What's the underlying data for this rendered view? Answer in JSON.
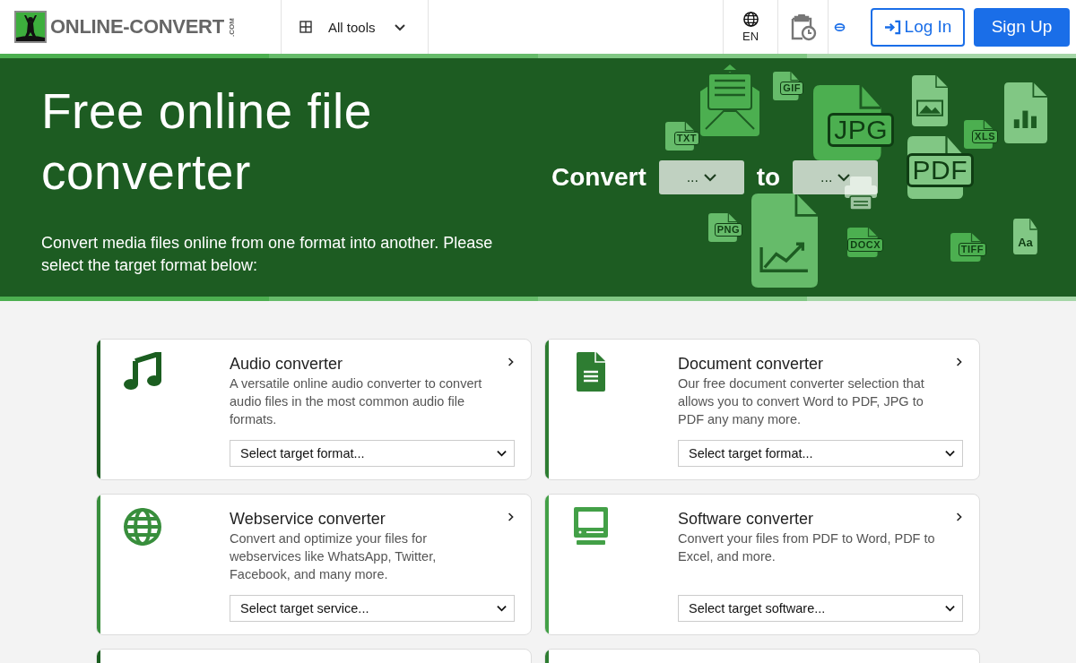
{
  "header": {
    "logo": {
      "text": "ONLINE-CONVERT",
      "suffix": ".COM"
    },
    "all_tools": "All tools",
    "language": "EN",
    "login": "Log In",
    "signup": "Sign Up"
  },
  "hero": {
    "title": "Free online file converter",
    "subtitle": "Convert media files online from one format into another. Please select the target format below:",
    "convert_label": "Convert",
    "from_select": "...",
    "to_label": "to",
    "to_select": "...",
    "decor": [
      {
        "kind": "envelope"
      },
      {
        "kind": "doc",
        "label": "GIF"
      },
      {
        "kind": "doc",
        "label": "JPG"
      },
      {
        "kind": "image-doc"
      },
      {
        "kind": "doc",
        "label": "XLS"
      },
      {
        "kind": "chart-doc"
      },
      {
        "kind": "doc",
        "label": "PDF"
      },
      {
        "kind": "doc",
        "label": "TXT"
      },
      {
        "kind": "printer"
      },
      {
        "kind": "trend-doc"
      },
      {
        "kind": "doc",
        "label": "PNG"
      },
      {
        "kind": "doc",
        "label": "DOCX"
      },
      {
        "kind": "doc",
        "label": "TIFF"
      },
      {
        "kind": "font-doc",
        "label": "Aa"
      }
    ]
  },
  "cards": [
    {
      "kind": "audio",
      "color": "#1b5e20",
      "title": "Audio converter",
      "description": "A versatile online audio converter to convert audio files in the most common audio file formats.",
      "dropdown": "Select target format..."
    },
    {
      "kind": "document",
      "color": "#2e7d32",
      "title": "Document converter",
      "description": "Our free document converter selection that allows you to convert Word to PDF, JPG to PDF any many more.",
      "dropdown": "Select target format..."
    },
    {
      "kind": "webservice",
      "color": "#388e3c",
      "title": "Webservice converter",
      "description": "Convert and optimize your files for webservices like WhatsApp, Twitter, Facebook, and many more.",
      "dropdown": "Select target service..."
    },
    {
      "kind": "software",
      "color": "#43a047",
      "title": "Software converter",
      "description": "Convert your files from PDF to Word, PDF to Excel, and more.",
      "dropdown": "Select target software..."
    },
    {
      "kind": "partial",
      "color": "#1b5e20"
    },
    {
      "kind": "partial",
      "color": "#2e7d32"
    }
  ]
}
